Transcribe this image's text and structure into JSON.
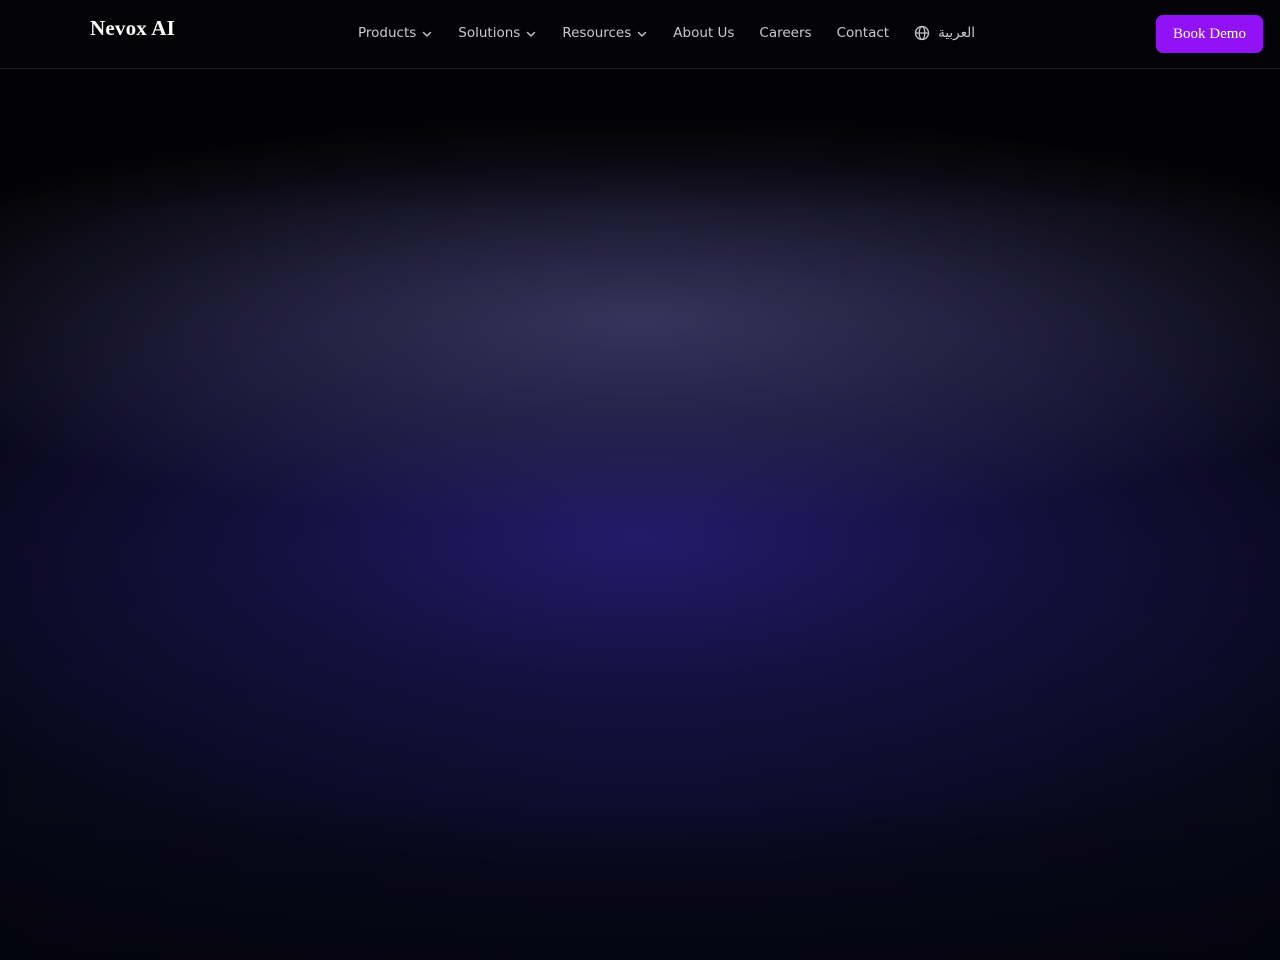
{
  "brand": {
    "name": "Nevox AI"
  },
  "nav": {
    "items": [
      {
        "label": "Products",
        "has_dropdown": true
      },
      {
        "label": "Solutions",
        "has_dropdown": true
      },
      {
        "label": "Resources",
        "has_dropdown": true
      },
      {
        "label": "About Us",
        "has_dropdown": false
      },
      {
        "label": "Careers",
        "has_dropdown": false
      },
      {
        "label": "Contact",
        "has_dropdown": false
      }
    ],
    "language": {
      "label": "العربية",
      "icon": "globe-icon"
    }
  },
  "cta": {
    "book_demo_label": "Book Demo"
  },
  "colors": {
    "background": "#020204",
    "nav_background": "#030305",
    "accent": "#9112f5",
    "glow_violet": "#2a1e80",
    "glow_gray": "#3e3a64"
  }
}
